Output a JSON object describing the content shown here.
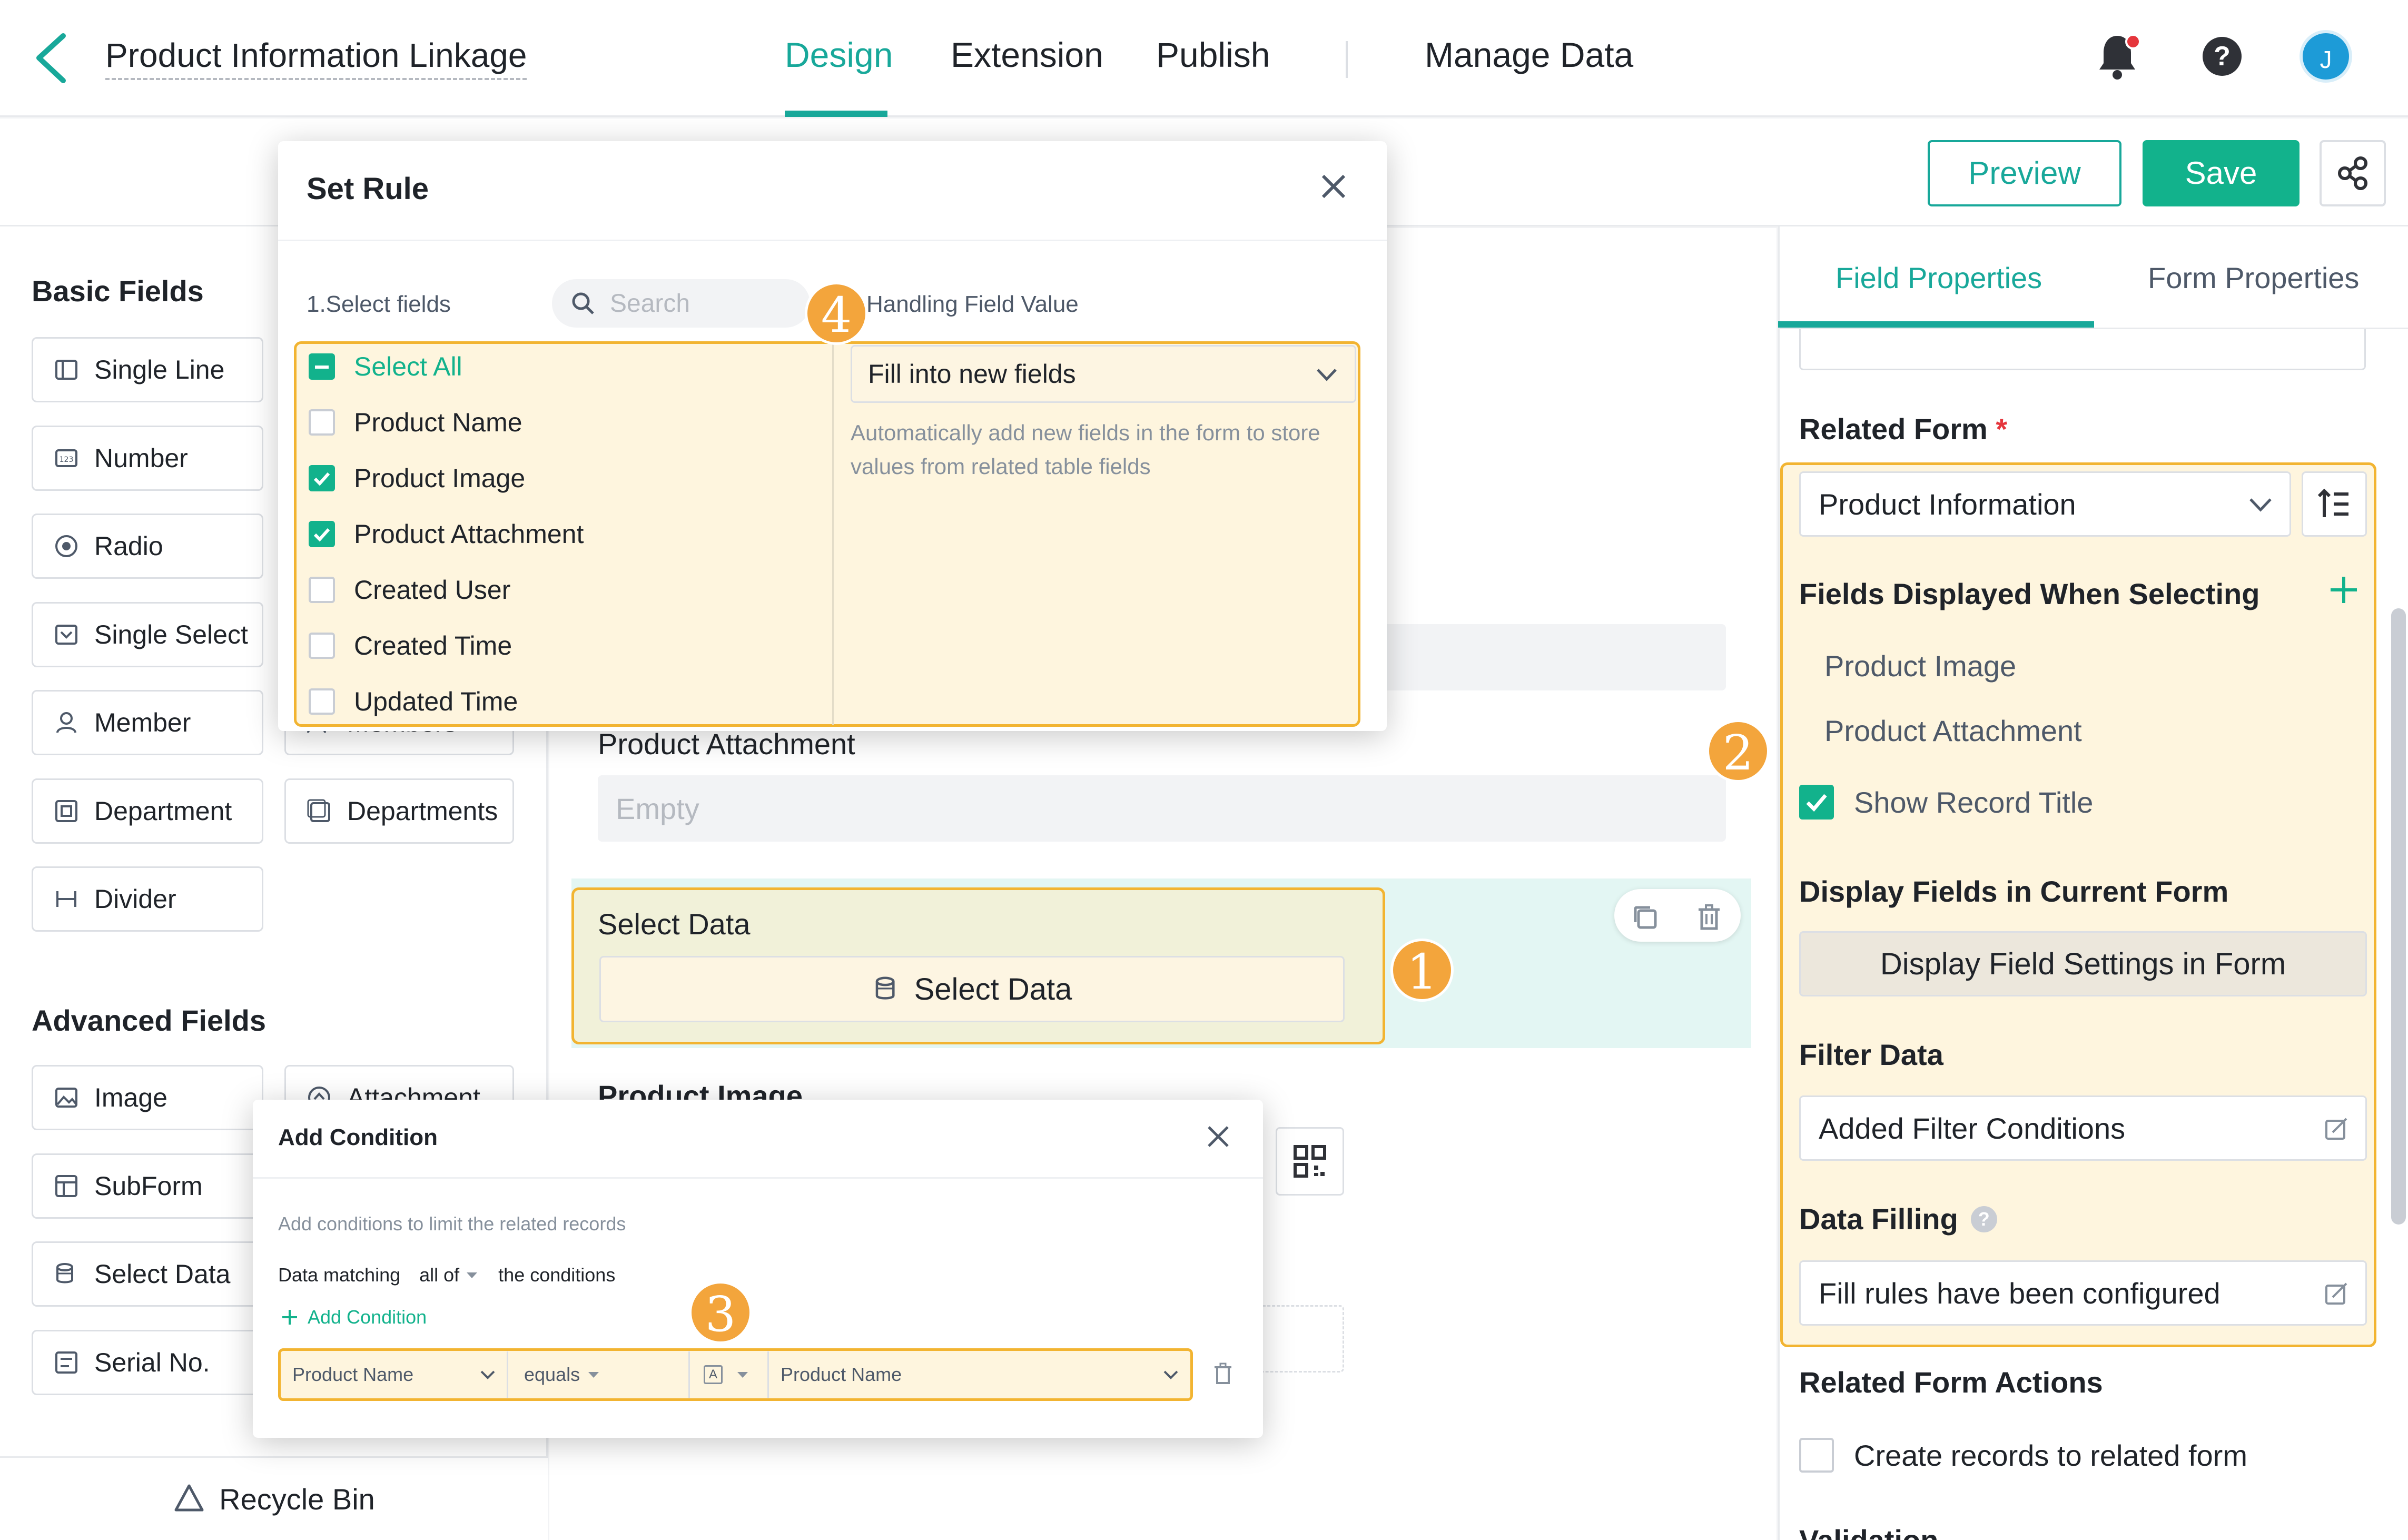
{
  "header": {
    "title": "Product Information Linkage",
    "tabs": {
      "design": "Design",
      "extension": "Extension",
      "publish": "Publish",
      "manage_data": "Manage Data"
    },
    "help": "?",
    "avatar": "J"
  },
  "toolbar": {
    "preview": "Preview",
    "save": "Save"
  },
  "left_panel": {
    "basic_title": "Basic Fields",
    "basic": {
      "single_line": "Single Line",
      "number": "Number",
      "radio": "Radio",
      "single_select": "Single Select",
      "member": "Member",
      "members": "Members",
      "department": "Department",
      "departments": "Departments",
      "divider": "Divider"
    },
    "advanced_title": "Advanced Fields",
    "advanced": {
      "image": "Image",
      "attachment": "Attachment",
      "subform": "SubForm",
      "select_data": "Select Data",
      "serial_no": "Serial No."
    },
    "recycle_bin": "Recycle Bin"
  },
  "canvas": {
    "product_attachment_label": "Product Attachment",
    "empty": "Empty",
    "select_data_label": "Select Data",
    "select_data_button": "Select Data",
    "product_image_label": "Product Image"
  },
  "right_panel": {
    "tabs": {
      "field_properties": "Field Properties",
      "form_properties": "Form Properties"
    },
    "related_form_label": "Related Form",
    "required_mark": "*",
    "related_form_value": "Product Information",
    "fields_displayed_label": "Fields Displayed When Selecting",
    "fields_displayed": [
      "Product Image",
      "Product Attachment"
    ],
    "show_record_title": "Show Record Title",
    "display_fields_label": "Display Fields in Current Form",
    "display_fields_button": "Display Field Settings in Form",
    "filter_data_label": "Filter Data",
    "filter_value": "Added Filter Conditions",
    "data_filling_label": "Data Filling",
    "data_filling_value": "Fill rules have been configured",
    "related_actions_label": "Related Form Actions",
    "create_records": "Create records to related form",
    "validation_partial": "Validation"
  },
  "set_rule_dialog": {
    "title": "Set Rule",
    "select_fields_label": "1.Select fields",
    "search_placeholder": "Search",
    "handling_label": "Handling Field Value",
    "options": [
      {
        "label": "Select All",
        "state": "indeterminate"
      },
      {
        "label": "Product Name",
        "state": "off"
      },
      {
        "label": "Product Image",
        "state": "on"
      },
      {
        "label": "Product Attachment",
        "state": "on"
      },
      {
        "label": "Created User",
        "state": "off"
      },
      {
        "label": "Created Time",
        "state": "off"
      },
      {
        "label": "Updated Time",
        "state": "off"
      }
    ],
    "handling_value": "Fill into new fields",
    "handling_hint_1": "Automatically add new fields in the form to store",
    "handling_hint_2": "values from related table fields"
  },
  "add_condition_dialog": {
    "title": "Add Condition",
    "hint": "Add conditions to limit the related records",
    "matching_prefix": "Data matching",
    "matching_value": "all of",
    "matching_suffix": "the conditions",
    "add_condition": "Add Condition",
    "row": {
      "field": "Product Name",
      "operator": "equals",
      "type_icon": "A",
      "value": "Product Name"
    }
  },
  "badges": {
    "b1": "1",
    "b2": "2",
    "b3": "3",
    "b4": "4"
  },
  "colors": {
    "accent": "#18a89a",
    "save": "#12b28c",
    "highlight_border": "#f2b431",
    "badge": "#f3a53c"
  }
}
